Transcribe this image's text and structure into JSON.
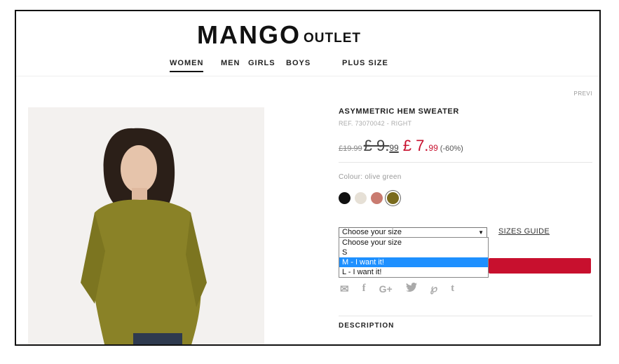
{
  "header": {
    "logo_main": "MANGO",
    "logo_sub": "OUTLET",
    "nav": [
      "WOMEN",
      "MEN",
      "GIRLS",
      "BOYS",
      "PLUS SIZE"
    ],
    "active_nav": "WOMEN"
  },
  "prev_label": "PREVI",
  "product": {
    "title": "ASYMMETRIC HEM SWEATER",
    "ref": "REF. 73070042 - RIGHT",
    "original_price": "£19.99",
    "mid_price_main": "£ 9.",
    "mid_price_cents": "99",
    "sale_price_main": "£ 7.",
    "sale_price_cents": "99",
    "discount": "(-60%)",
    "colour_label": "Colour: olive green",
    "colours": [
      {
        "name": "black",
        "hex": "#111111"
      },
      {
        "name": "ecru",
        "hex": "#e6e0d6"
      },
      {
        "name": "coral",
        "hex": "#c97b70"
      },
      {
        "name": "olive green",
        "hex": "#7a6b1e",
        "selected": true
      }
    ],
    "size_select": {
      "value": "Choose your size",
      "options": [
        "Choose your size",
        "S",
        "M - I want it!",
        "L - I want it!"
      ],
      "highlighted": "M - I want it!"
    },
    "sizes_guide": "SIZES GUIDE",
    "share_icons": [
      "mail-icon",
      "facebook-icon",
      "google-plus-icon",
      "twitter-icon",
      "pinterest-icon",
      "tumblr-icon"
    ],
    "description_label": "DESCRIPTION"
  },
  "colors": {
    "accent": "#c8102e",
    "highlight": "#1e90ff"
  }
}
